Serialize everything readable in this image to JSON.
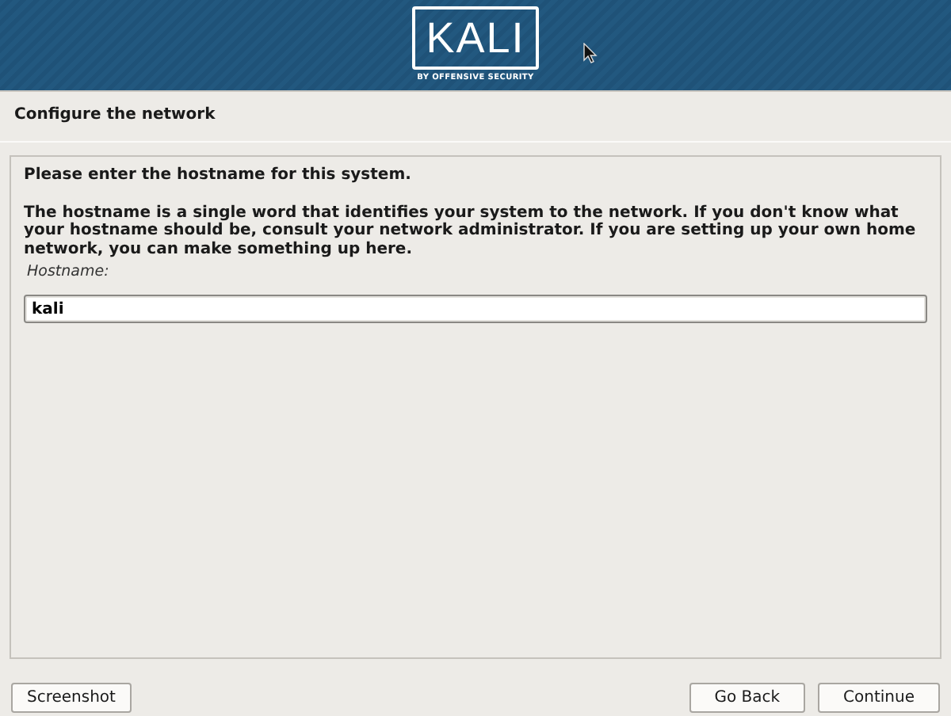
{
  "banner": {
    "logo_text": "KALI",
    "logo_subtitle": "BY OFFENSIVE SECURITY"
  },
  "step_title": "Configure the network",
  "prompt": "Please enter the hostname for this system.",
  "description": "The hostname is a single word that identifies your system to the network. If you don't know what your hostname should be, consult your network administrator. If you are setting up your own home network, you can make something up here.",
  "field": {
    "label": "Hostname:",
    "value": "kali"
  },
  "buttons": [
    {
      "label": "Screenshot",
      "kind": "left"
    },
    {
      "label": "Go Back",
      "kind": "right"
    },
    {
      "label": "Continue",
      "kind": "right"
    }
  ]
}
